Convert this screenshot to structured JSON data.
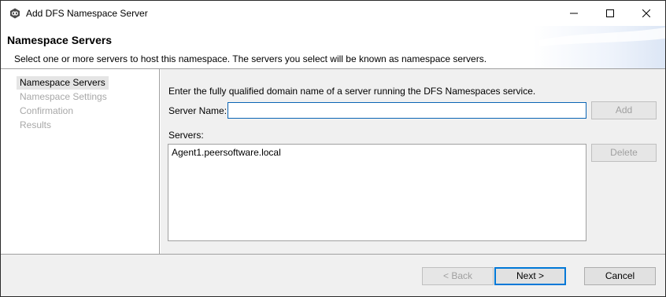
{
  "window": {
    "title": "Add DFS Namespace Server",
    "icon": "peer-logo-icon",
    "controls": [
      "minimize-icon",
      "maximize-icon",
      "close-icon"
    ]
  },
  "banner": {
    "title": "Namespace Servers",
    "description": "Select one or more servers to host this namespace. The servers you select will be known as namespace servers."
  },
  "nav": {
    "items": [
      {
        "label": "Namespace Servers",
        "active": true
      },
      {
        "label": "Namespace Settings",
        "active": false
      },
      {
        "label": "Confirmation",
        "active": false
      },
      {
        "label": "Results",
        "active": false
      }
    ]
  },
  "content": {
    "instruction": "Enter the fully qualified domain name of a server running the DFS Namespaces service.",
    "server_name_label": "Server Name:",
    "server_name_value": "",
    "add_label": "Add",
    "servers_label": "Servers:",
    "servers": [
      "Agent1.peersoftware.local"
    ],
    "delete_label": "Delete"
  },
  "footer": {
    "back_label": "< Back",
    "next_label": "Next >",
    "cancel_label": "Cancel"
  },
  "colors": {
    "accent": "#0078d7",
    "panel": "#f0f0f0",
    "disabled_text": "#a0a0a0"
  }
}
